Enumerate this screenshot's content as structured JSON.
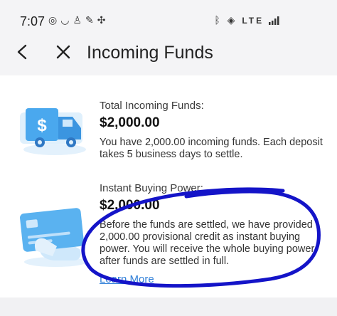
{
  "status_bar": {
    "time": "7:07",
    "left_icons": [
      "at-icon",
      "bluetooth-headset-icon",
      "person-icon",
      "feather-icon",
      "fan-icon"
    ],
    "right_icons": [
      "bluetooth-icon",
      "volte-icon",
      "lte-icon",
      "signal-icon"
    ],
    "lte_label": "LTE"
  },
  "header": {
    "title": "Incoming Funds"
  },
  "total_section": {
    "label": "Total Incoming Funds:",
    "amount": "$2,000.00",
    "description": "You have 2,000.00 incoming funds. Each deposit takes 5 business days to settle."
  },
  "instant_section": {
    "label": "Instant Buying Power:",
    "amount": "$2,000.00",
    "description": "Before the funds are settled, we have provided 2,000.00 provisional credit as instant buying power. You will receive the whole buying power after funds are settled in full.",
    "link": "Learn More"
  },
  "colors": {
    "accent": "#2f7fd8",
    "illustration": "#4aa8ee",
    "annotation": "#1414c8"
  }
}
